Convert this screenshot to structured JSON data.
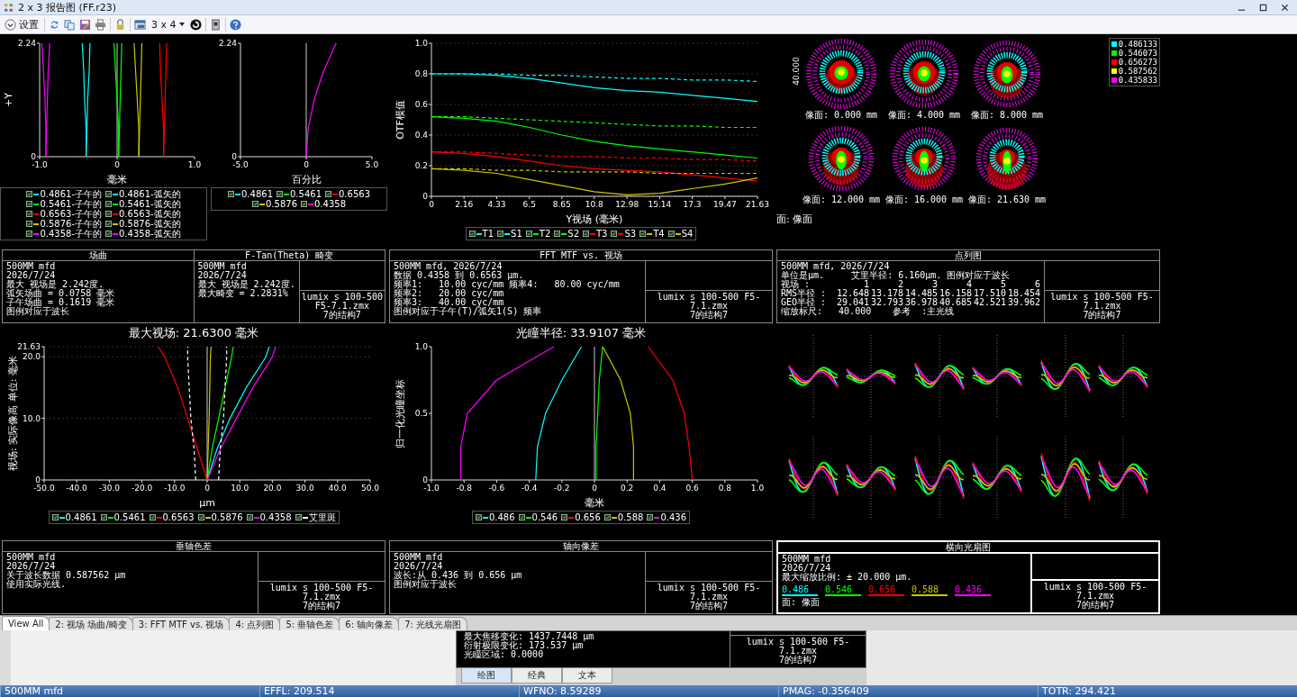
{
  "window": {
    "title": "2 x 3 报告图 (FF.r23)"
  },
  "toolbar": {
    "settings_label": "设置",
    "layout_label": "3 x 4"
  },
  "windows": [
    {
      "kind": "field",
      "plots": [
        {
          "chart_data": {
            "type": "line",
            "orientation": "horizontal",
            "xlabel": "毫米",
            "ylabel": "+Y",
            "xlim": [
              -1,
              1
            ],
            "ylim": [
              0,
              2.24
            ],
            "xticks": [
              {
                "value": -1,
                "label": "-1.0"
              },
              0,
              {
                "value": 1,
                "label": "1.0"
              }
            ],
            "yticks": [
              0,
              2.24
            ],
            "x": [
              0,
              0.56,
              1.12,
              1.68,
              2.24
            ],
            "series": [
              {
                "name": "0.4861-子午的",
                "line_style": "solid",
                "color": "#00ffff",
                "values": [
                  -0.4,
                  -0.4,
                  -0.42,
                  -0.43,
                  -0.45
                ]
              },
              {
                "name": "0.4861-弧矢的",
                "line_style": "solid",
                "color": "#00ffff",
                "values": [
                  -0.4,
                  -0.39,
                  -0.38,
                  -0.36,
                  -0.35
                ]
              },
              {
                "name": "0.5461-子午的",
                "line_style": "solid",
                "color": "#00ff00",
                "values": [
                  0.02,
                  0.02,
                  0,
                  -0.02,
                  -0.04
                ]
              },
              {
                "name": "0.5461-弧矢的",
                "line_style": "solid",
                "color": "#00ff00",
                "values": [
                  0.02,
                  0.03,
                  0.04,
                  0.05,
                  0.06
                ]
              },
              {
                "name": "0.6563-子午的",
                "line_style": "solid",
                "color": "#ff0000",
                "values": [
                  0.6,
                  0.6,
                  0.58,
                  0.56,
                  0.55
                ]
              },
              {
                "name": "0.6563-弧矢的",
                "line_style": "solid",
                "color": "#ff0000",
                "values": [
                  0.6,
                  0.61,
                  0.62,
                  0.63,
                  0.64
                ]
              },
              {
                "name": "0.5876-子午的",
                "line_style": "solid",
                "color": "#c8c800",
                "values": [
                  0.28,
                  0.28,
                  0.26,
                  0.24,
                  0.22
                ]
              },
              {
                "name": "0.5876-弧矢的",
                "line_style": "solid",
                "color": "#c8c800",
                "values": [
                  0.28,
                  0.29,
                  0.3,
                  0.31,
                  0.32
                ]
              },
              {
                "name": "0.4358-子午的",
                "line_style": "solid",
                "color": "#ff00ff",
                "values": [
                  -0.92,
                  -0.92,
                  -0.93,
                  -0.95,
                  -0.97
                ]
              },
              {
                "name": "0.4358-弧矢的",
                "line_style": "solid",
                "color": "#ff00ff",
                "values": [
                  -0.92,
                  -0.91,
                  -0.9,
                  -0.89,
                  -0.87
                ]
              }
            ]
          }
        },
        {
          "chart_data": {
            "type": "line",
            "orientation": "horizontal",
            "xlabel": "百分比",
            "xlim": [
              -5,
              5
            ],
            "ylim": [
              0,
              2.24
            ],
            "xticks": [
              {
                "value": -5,
                "label": "-5.0"
              },
              0,
              {
                "value": 5,
                "label": "5.0"
              }
            ],
            "yticks": [
              0,
              2.24
            ],
            "x": [
              0,
              0.56,
              1.12,
              1.68,
              2.24
            ],
            "series": [
              {
                "name": "0.4861",
                "line_style": "solid",
                "color": "#00ffff",
                "values": [
                  null,
                  null,
                  null,
                  null,
                  null
                ]
              },
              {
                "name": "0.5461",
                "line_style": "solid",
                "color": "#00ff00",
                "values": [
                  null,
                  null,
                  null,
                  null,
                  null
                ]
              },
              {
                "name": "0.6563",
                "line_style": "solid",
                "color": "#ff0000",
                "values": [
                  null,
                  null,
                  null,
                  null,
                  null
                ]
              },
              {
                "name": "0.5876",
                "line_style": "solid",
                "color": "#c8c800",
                "values": [
                  null,
                  null,
                  null,
                  null,
                  null
                ]
              },
              {
                "name": "0.4358",
                "line_style": "solid",
                "color": "#ff00ff",
                "values": [
                  0,
                  0.15,
                  0.6,
                  1.3,
                  2.28
                ]
              }
            ]
          }
        }
      ],
      "info": [
        {
          "title": "场曲",
          "lines": [
            "500MM mfd",
            "2026/7/24",
            "最大 视场是 2.242度.",
            "弧矢场曲 = 0.0758 毫米",
            "子午场曲 = 0.1619 毫米",
            "图例对应于波长"
          ]
        },
        {
          "title": "F-Tan(Theta) 畸变",
          "lines": [
            "500MM mfd",
            "2026/7/24",
            "最大 视场是 2.242度.",
            "最大畸变 = 2.2831%"
          ],
          "file": [
            "lumix s 100-500 F5-7.1.zmx",
            "7的结构7"
          ]
        }
      ]
    },
    {
      "kind": "mtf",
      "plots": [
        {
          "chart_data": {
            "type": "line",
            "grid": true,
            "xlabel": "Y视场 (毫米)",
            "ylabel": "OTF模值",
            "xlim": [
              0,
              21.63
            ],
            "ylim": [
              0,
              1
            ],
            "xticks": [
              0,
              2.16,
              4.33,
              6.5,
              8.65,
              10.8,
              12.98,
              15.14,
              17.3,
              19.47,
              21.63
            ],
            "yticks": [
              0,
              0.2,
              0.4,
              0.6,
              0.8,
              {
                "value": 1,
                "label": "1.0"
              }
            ],
            "x": [
              0,
              2.16,
              4.33,
              6.5,
              8.65,
              10.8,
              12.98,
              15.14,
              17.3,
              19.47,
              21.63
            ],
            "series": [
              {
                "name": "T1",
                "line_style": "solid",
                "color": "#00ffff",
                "values": [
                  0.8,
                  0.8,
                  0.79,
                  0.77,
                  0.74,
                  0.71,
                  0.69,
                  0.68,
                  0.66,
                  0.64,
                  0.62
                ]
              },
              {
                "name": "S1",
                "line_style": "dashed",
                "color": "#00ffff",
                "values": [
                  0.8,
                  0.8,
                  0.8,
                  0.79,
                  0.79,
                  0.78,
                  0.77,
                  0.77,
                  0.76,
                  0.76,
                  0.75
                ]
              },
              {
                "name": "T2",
                "line_style": "solid",
                "color": "#00ff00",
                "values": [
                  0.52,
                  0.51,
                  0.49,
                  0.45,
                  0.4,
                  0.36,
                  0.33,
                  0.31,
                  0.29,
                  0.27,
                  0.25
                ]
              },
              {
                "name": "S2",
                "line_style": "dashed",
                "color": "#00ff00",
                "values": [
                  0.52,
                  0.52,
                  0.51,
                  0.5,
                  0.49,
                  0.48,
                  0.47,
                  0.46,
                  0.46,
                  0.45,
                  0.45
                ]
              },
              {
                "name": "T3",
                "line_style": "solid",
                "color": "#ff0000",
                "values": [
                  0.29,
                  0.28,
                  0.26,
                  0.23,
                  0.2,
                  0.18,
                  0.17,
                  0.16,
                  0.14,
                  0.12,
                  0.1
                ]
              },
              {
                "name": "S3",
                "line_style": "dashed",
                "color": "#ff0000",
                "values": [
                  0.29,
                  0.29,
                  0.28,
                  0.27,
                  0.26,
                  0.26,
                  0.25,
                  0.25,
                  0.24,
                  0.24,
                  0.23
                ]
              },
              {
                "name": "T4",
                "line_style": "solid",
                "color": "#c8c800",
                "values": [
                  0.18,
                  0.17,
                  0.15,
                  0.11,
                  0.07,
                  0.03,
                  0.01,
                  0.02,
                  0.05,
                  0.08,
                  0.12
                ]
              },
              {
                "name": "S4",
                "line_style": "dashed",
                "color": "#c8c800",
                "values": [
                  0.18,
                  0.18,
                  0.17,
                  0.17,
                  0.16,
                  0.16,
                  0.16,
                  0.15,
                  0.15,
                  0.15,
                  0.15
                ]
              }
            ]
          }
        }
      ],
      "info": [
        {
          "title": "FFT MTF vs. 视场",
          "lines": [
            "500MM mfd, 2026/7/24",
            "数据 0.4358 到 0.6563 µm.",
            "频率1:   10.00 cyc/mm 频率4:   80.00 cyc/mm",
            "频率2:   20.00 cyc/mm",
            "频率3:   40.00 cyc/mm",
            "图例对应于子午(T)/弧矢1(S) 频率"
          ],
          "file": [
            "lumix s 100-500 F5-7.1.zmx",
            "7的结构7"
          ]
        }
      ]
    },
    {
      "kind": "spot",
      "scale_label": "40.000",
      "surface_label": "面: 像面",
      "legend": [
        {
          "label": "0.486133",
          "color": "#00ffff"
        },
        {
          "label": "0.546073",
          "color": "#00ff00"
        },
        {
          "label": "0.656273",
          "color": "#ff0000"
        },
        {
          "label": "0.587562",
          "color": "#ffff00"
        },
        {
          "label": "0.435833",
          "color": "#ff00ff"
        }
      ],
      "spots": [
        {
          "label": "像面: 0.000 mm"
        },
        {
          "label": "像面: 4.000 mm"
        },
        {
          "label": "像面: 8.000 mm"
        },
        {
          "label": "像面: 12.000 mm"
        },
        {
          "label": "像面: 16.000 mm"
        },
        {
          "label": "像面: 21.630 mm"
        }
      ],
      "info": [
        {
          "title": "点列图",
          "lines": [
            "500MM mfd, 2026/7/24",
            "单位是µm.     艾里半径: 6.160µm. 图例对应于波长"
          ],
          "table": [
            [
              "视场 :",
              "1",
              "2",
              "3",
              "4",
              "5",
              "6"
            ],
            [
              "RMS半径 :",
              "12.648",
              "13.178",
              "14.485",
              "16.158",
              "17.510",
              "18.454"
            ],
            [
              "GEO半径 :",
              "29.041",
              "32.793",
              "36.978",
              "40.685",
              "42.521",
              "39.962"
            ]
          ],
          "lines_after": [
            "缩放标尺:   40.000    参考  :主光线"
          ],
          "file": [
            "lumix s 100-500 F5-7.1.zmx",
            "7的结构7"
          ]
        }
      ]
    },
    {
      "kind": "lateral",
      "plots": [
        {
          "chart_data": {
            "type": "line",
            "grid": true,
            "orientation": "horizontal",
            "title": "最大视场: 21.6300 毫米",
            "xlabel": "µm",
            "ylabel": "视场: 实际像高 单位: 毫米",
            "xlim": [
              -50,
              50
            ],
            "ylim": [
              0,
              21.63
            ],
            "xticks": [
              {
                "value": -50,
                "label": "-50.0"
              },
              {
                "value": -40,
                "label": "-40.0"
              },
              {
                "value": -30,
                "label": "-30.0"
              },
              {
                "value": -20,
                "label": "-20.0"
              },
              {
                "value": -10,
                "label": "-10.0"
              },
              0,
              {
                "value": 10,
                "label": "10.0"
              },
              {
                "value": 20,
                "label": "20.0"
              },
              {
                "value": 30,
                "label": "30.0"
              },
              {
                "value": 40,
                "label": "40.0"
              },
              {
                "value": 50,
                "label": "50.0"
              }
            ],
            "yticks": [
              0,
              {
                "value": 10,
                "label": "10.0"
              },
              {
                "value": 20,
                "label": "20.0"
              },
              21.63
            ],
            "x": [
              0,
              5,
              10,
              15,
              20,
              21.63
            ],
            "series": [
              {
                "name": "0.4861",
                "line_style": "solid",
                "color": "#00ffff",
                "values": [
                  0,
                  3,
                  7,
                  12,
                  18,
                  19
                ]
              },
              {
                "name": "0.5461",
                "line_style": "solid",
                "color": "#00ff00",
                "values": [
                  0,
                  1.5,
                  3.5,
                  5.5,
                  7.5,
                  8
                ]
              },
              {
                "name": "0.6563",
                "line_style": "solid",
                "color": "#ff0000",
                "values": [
                  0,
                  -3,
                  -6,
                  -9,
                  -13,
                  -15
                ]
              },
              {
                "name": "0.5876",
                "line_style": "solid",
                "color": "#c8c800",
                "values": [
                  0,
                  0.3,
                  0.6,
                  0.8,
                  1,
                  1.2
                ]
              },
              {
                "name": "0.4358",
                "line_style": "solid",
                "color": "#ff00ff",
                "values": [
                  0,
                  4,
                  9,
                  14,
                  20,
                  21
                ]
              },
              {
                "name": "艾里斑",
                "line_style": "dashed",
                "color": "#ffffff",
                "values": [
                  3.5,
                  4,
                  5,
                  5.5,
                  6,
                  6
                ]
              },
              {
                "line_style": "dashed",
                "color": "#ffffff",
                "values": [
                  -3.5,
                  -4,
                  -5,
                  -5.5,
                  -6,
                  -6
                ]
              }
            ]
          }
        }
      ],
      "info": [
        {
          "title": "垂轴色差",
          "lines": [
            "500MM mfd",
            "2026/7/24",
            "关于波长数据 0.587562 µm",
            "使用实际光线."
          ],
          "file": [
            "lumix s 100-500 F5-7.1.zmx",
            "7的结构7"
          ]
        }
      ]
    },
    {
      "kind": "axial",
      "plots": [
        {
          "chart_data": {
            "type": "line",
            "orientation": "horizontal",
            "title": "光瞳半径: 33.9107 毫米",
            "xlabel": "毫米",
            "ylabel": "归一化光瞳坐标",
            "xlim": [
              -1,
              1
            ],
            "ylim": [
              0,
              1
            ],
            "xticks": [
              {
                "value": -1,
                "label": "-1.0"
              },
              -0.8,
              -0.6,
              -0.4,
              -0.2,
              0,
              0.2,
              0.4,
              0.6,
              0.8,
              {
                "value": 1,
                "label": "1.0"
              }
            ],
            "yticks": [
              0,
              0.5,
              {
                "value": 1,
                "label": "1.0"
              }
            ],
            "x": [
              0,
              0.25,
              0.5,
              0.75,
              1
            ],
            "series": [
              {
                "name": "0.486",
                "line_style": "solid",
                "color": "#00ffff",
                "values": [
                  -0.36,
                  -0.35,
                  -0.3,
                  -0.2,
                  -0.08
                ]
              },
              {
                "name": "0.546",
                "line_style": "solid",
                "color": "#00ff00",
                "values": [
                  0.01,
                  0.01,
                  0.02,
                  0.03,
                  0.05
                ]
              },
              {
                "name": "0.656",
                "line_style": "solid",
                "color": "#ff0000",
                "values": [
                  0.6,
                  0.58,
                  0.55,
                  0.48,
                  0.33
                ]
              },
              {
                "name": "0.588",
                "line_style": "solid",
                "color": "#c8c800",
                "values": [
                  0.24,
                  0.24,
                  0.22,
                  0.16,
                  0.05
                ]
              },
              {
                "name": "0.436",
                "line_style": "solid",
                "color": "#ff00ff",
                "values": [
                  -0.82,
                  -0.82,
                  -0.78,
                  -0.6,
                  -0.25
                ]
              }
            ]
          }
        }
      ],
      "info": [
        {
          "title": "轴向像差",
          "lines": [
            "500MM mfd",
            "2026/7/24",
            "波长:从 0.436 到 0.656 µm",
            "图例对应于波长"
          ],
          "file": [
            "lumix s 100-500 F5-7.1.zmx",
            "7的结构7"
          ]
        }
      ]
    },
    {
      "kind": "fan",
      "info": [
        {
          "title": "横向光扇图",
          "lines": [
            "500MM mfd",
            "2026/7/24",
            "最大缩放比例: ± 20.000 µm."
          ],
          "wavelengths": [
            {
              "label": "0.486",
              "color": "#00ffff"
            },
            {
              "label": "0.546",
              "color": "#00ff00"
            },
            {
              "label": "0.656",
              "color": "#ff0000"
            },
            {
              "label": "0.588",
              "color": "#c8c800"
            },
            {
              "label": "0.436",
              "color": "#ff00ff"
            }
          ],
          "footer": "面: 像面",
          "file": [
            "lumix s 100-500 F5-7.1.zmx",
            "7的结构7"
          ]
        }
      ]
    }
  ],
  "tabs": [
    {
      "label": "View All",
      "selected": true
    },
    {
      "label": "2: 视场 场曲/畸变",
      "selected": false
    },
    {
      "label": "3: FFT MTF vs. 视场",
      "selected": false
    },
    {
      "label": "4: 点列图",
      "selected": false
    },
    {
      "label": "5: 垂轴色差",
      "selected": false
    },
    {
      "label": "6: 轴向像差",
      "selected": false
    },
    {
      "label": "7: 光线光扇图",
      "selected": false
    }
  ],
  "text_window": {
    "lines": [
      "最大焦移变化: 1437.7448 µm",
      "衍射极限变化: 173.537 µm",
      "光瞳区域: 0.0000"
    ],
    "file": [
      "lumix s 100-500 F5-7.1.zmx",
      "7的结构7"
    ],
    "tabs": [
      {
        "label": "绘图",
        "selected": true
      },
      {
        "label": "经典",
        "selected": false
      },
      {
        "label": "文本",
        "selected": false
      }
    ]
  },
  "status_bar": [
    "500MM mfd",
    "EFFL: 209.514",
    "WFNO: 8.59289",
    "PMAG: -0.356409",
    "TOTR: 294.421"
  ]
}
